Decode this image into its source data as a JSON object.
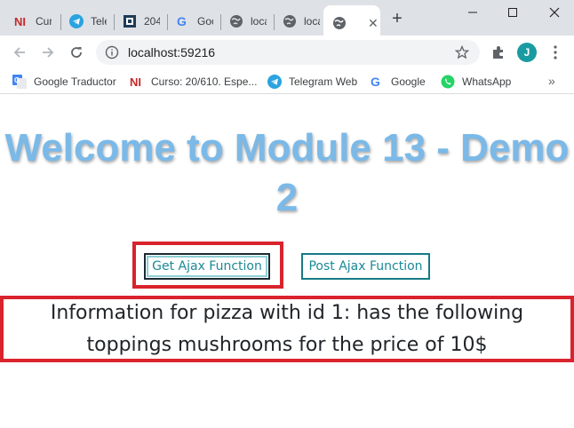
{
  "browser": {
    "tabs": [
      {
        "label": "Cur",
        "icon": "ni-icon"
      },
      {
        "label": "Tele",
        "icon": "telegram-icon"
      },
      {
        "label": "204",
        "icon": "doc-icon"
      },
      {
        "label": "Goo",
        "icon": "google-icon"
      },
      {
        "label": "loca",
        "icon": "globe-icon"
      },
      {
        "label": "loca",
        "icon": "globe-icon"
      },
      {
        "label": "",
        "icon": "globe-icon",
        "active": true
      }
    ],
    "close_glyph": "✕",
    "new_tab_glyph": "+",
    "url": "localhost:59216",
    "profile_initial": "J",
    "bookmarks": [
      {
        "label": "Google Traductor",
        "icon": "translate-icon"
      },
      {
        "label": "Curso: 20/610. Espe...",
        "icon": "ni-icon"
      },
      {
        "label": "Telegram Web",
        "icon": "telegram-icon"
      },
      {
        "label": "Google",
        "icon": "google-icon"
      },
      {
        "label": "WhatsApp",
        "icon": "whatsapp-icon"
      }
    ],
    "bookmarks_more": "»"
  },
  "page": {
    "heading": "Welcome to Module 13 - Demo 2",
    "get_button_label": "Get Ajax Function",
    "post_button_label": "Post Ajax Function",
    "result_text": "Information for pizza with id 1: has the following toppings mushrooms for the price of 10$"
  },
  "colors": {
    "heading": "#7ab9e8",
    "button_text": "#1b8a95",
    "highlight_border": "#d9232d",
    "tabstrip": "#dee1e6"
  }
}
